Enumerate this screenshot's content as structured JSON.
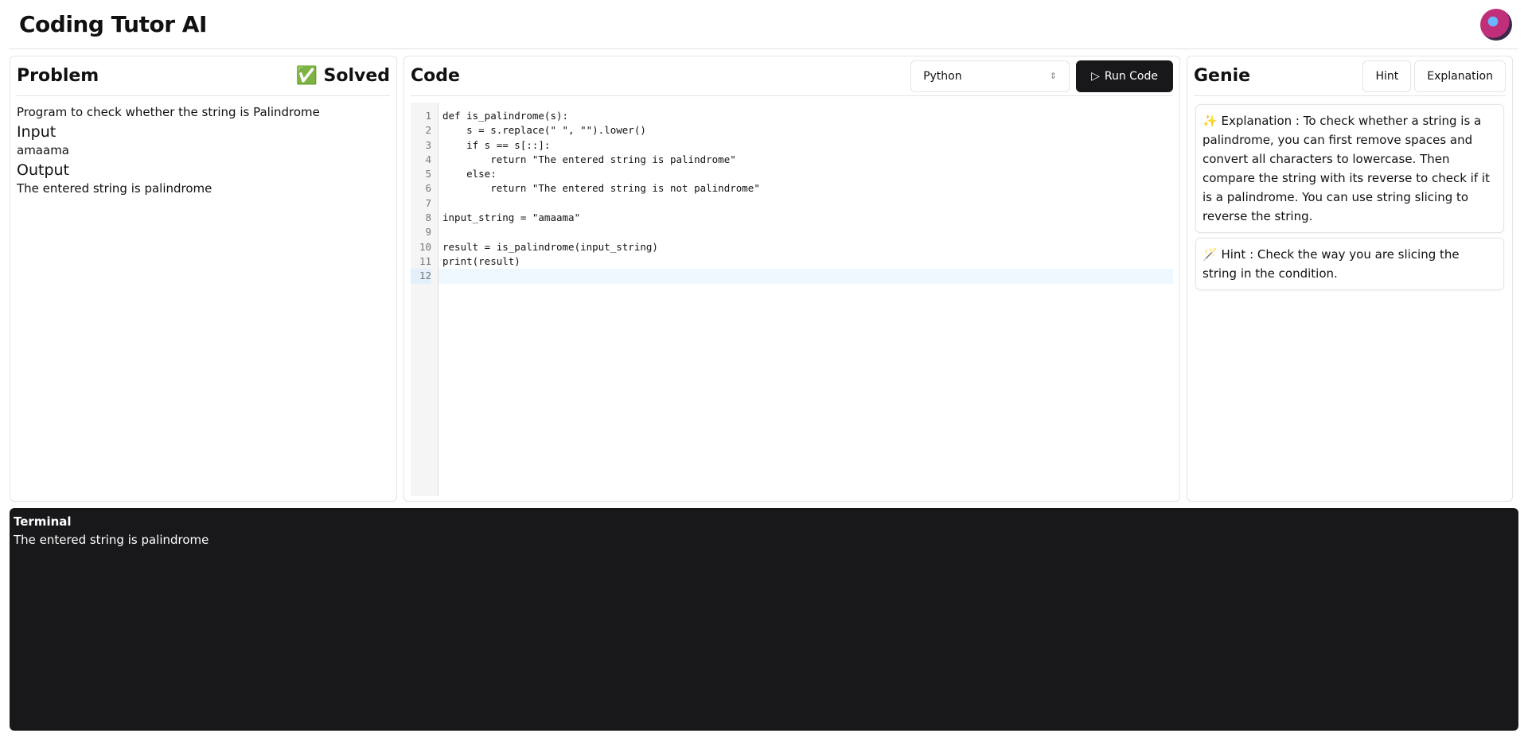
{
  "header": {
    "title": "Coding Tutor AI",
    "avatar_icon": "user-avatar"
  },
  "problem": {
    "title": "Problem",
    "status": "✅ Solved",
    "description": "Program to check whether the string is Palindrome",
    "input_label": "Input",
    "input_value": "amaama",
    "output_label": "Output",
    "output_value": "The entered string is palindrome"
  },
  "code": {
    "title": "Code",
    "language": "Python",
    "run_label": "Run Code",
    "line_numbers": [
      "1",
      "2",
      "3",
      "4",
      "5",
      "6",
      "7",
      "8",
      "9",
      "10",
      "11",
      "12"
    ],
    "lines": [
      "def is_palindrome(s):",
      "    s = s.replace(\" \", \"\").lower()",
      "    if s == s[::]:",
      "        return \"The entered string is palindrome\"",
      "    else:",
      "        return \"The entered string is not palindrome\"",
      "",
      "input_string = \"amaama\"",
      "",
      "result = is_palindrome(input_string)",
      "print(result)",
      ""
    ],
    "active_line": 12
  },
  "genie": {
    "title": "Genie",
    "hint_label": "Hint",
    "explanation_label": "Explanation",
    "messages": [
      {
        "icon": "✨",
        "text": "Explanation : To check whether a string is a palindrome, you can first remove spaces and convert all characters to lowercase. Then compare the string with its reverse to check if it is a palindrome. You can use string slicing to reverse the string."
      },
      {
        "icon": "🪄",
        "text": "Hint : Check the way you are slicing the string in the condition."
      }
    ]
  },
  "terminal": {
    "title": "Terminal",
    "output": "The entered string is palindrome"
  }
}
